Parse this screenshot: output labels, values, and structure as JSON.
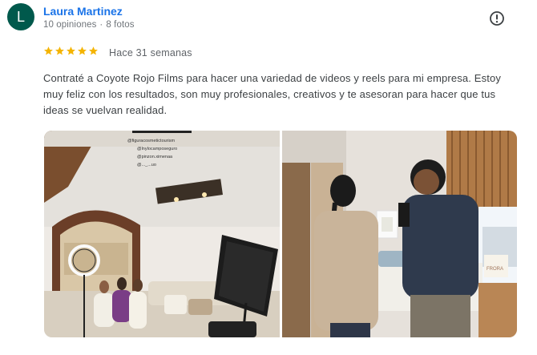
{
  "reviewer": {
    "initial": "L",
    "name": "Laura Martinez",
    "reviews": "10 opiniones",
    "photos": "8 fotos"
  },
  "rating": {
    "stars": 5,
    "max": 5,
    "color": "#f4b400"
  },
  "time_ago": "Hace 31 semanas",
  "review_text": "Contraté a Coyote Rojo Films para hacer una variedad de videos y reels para mi empresa. Estoy muy feliz con los resultados, son muy profesionales, creativos y te asesoran para hacer que tus ideas se vuelvan realidad.",
  "photo1_tags": [
    "@figuracosmetictourism",
    "@lnylocamposeguro",
    "@pinzon.ximenaa",
    "@..._...uo"
  ],
  "photo2_sign": "FRORA",
  "icons": {
    "report": "report-flag-icon",
    "star": "star-icon"
  },
  "colors": {
    "accent": "#1a73e8",
    "avatar": "#00594c",
    "star": "#f4b400"
  }
}
